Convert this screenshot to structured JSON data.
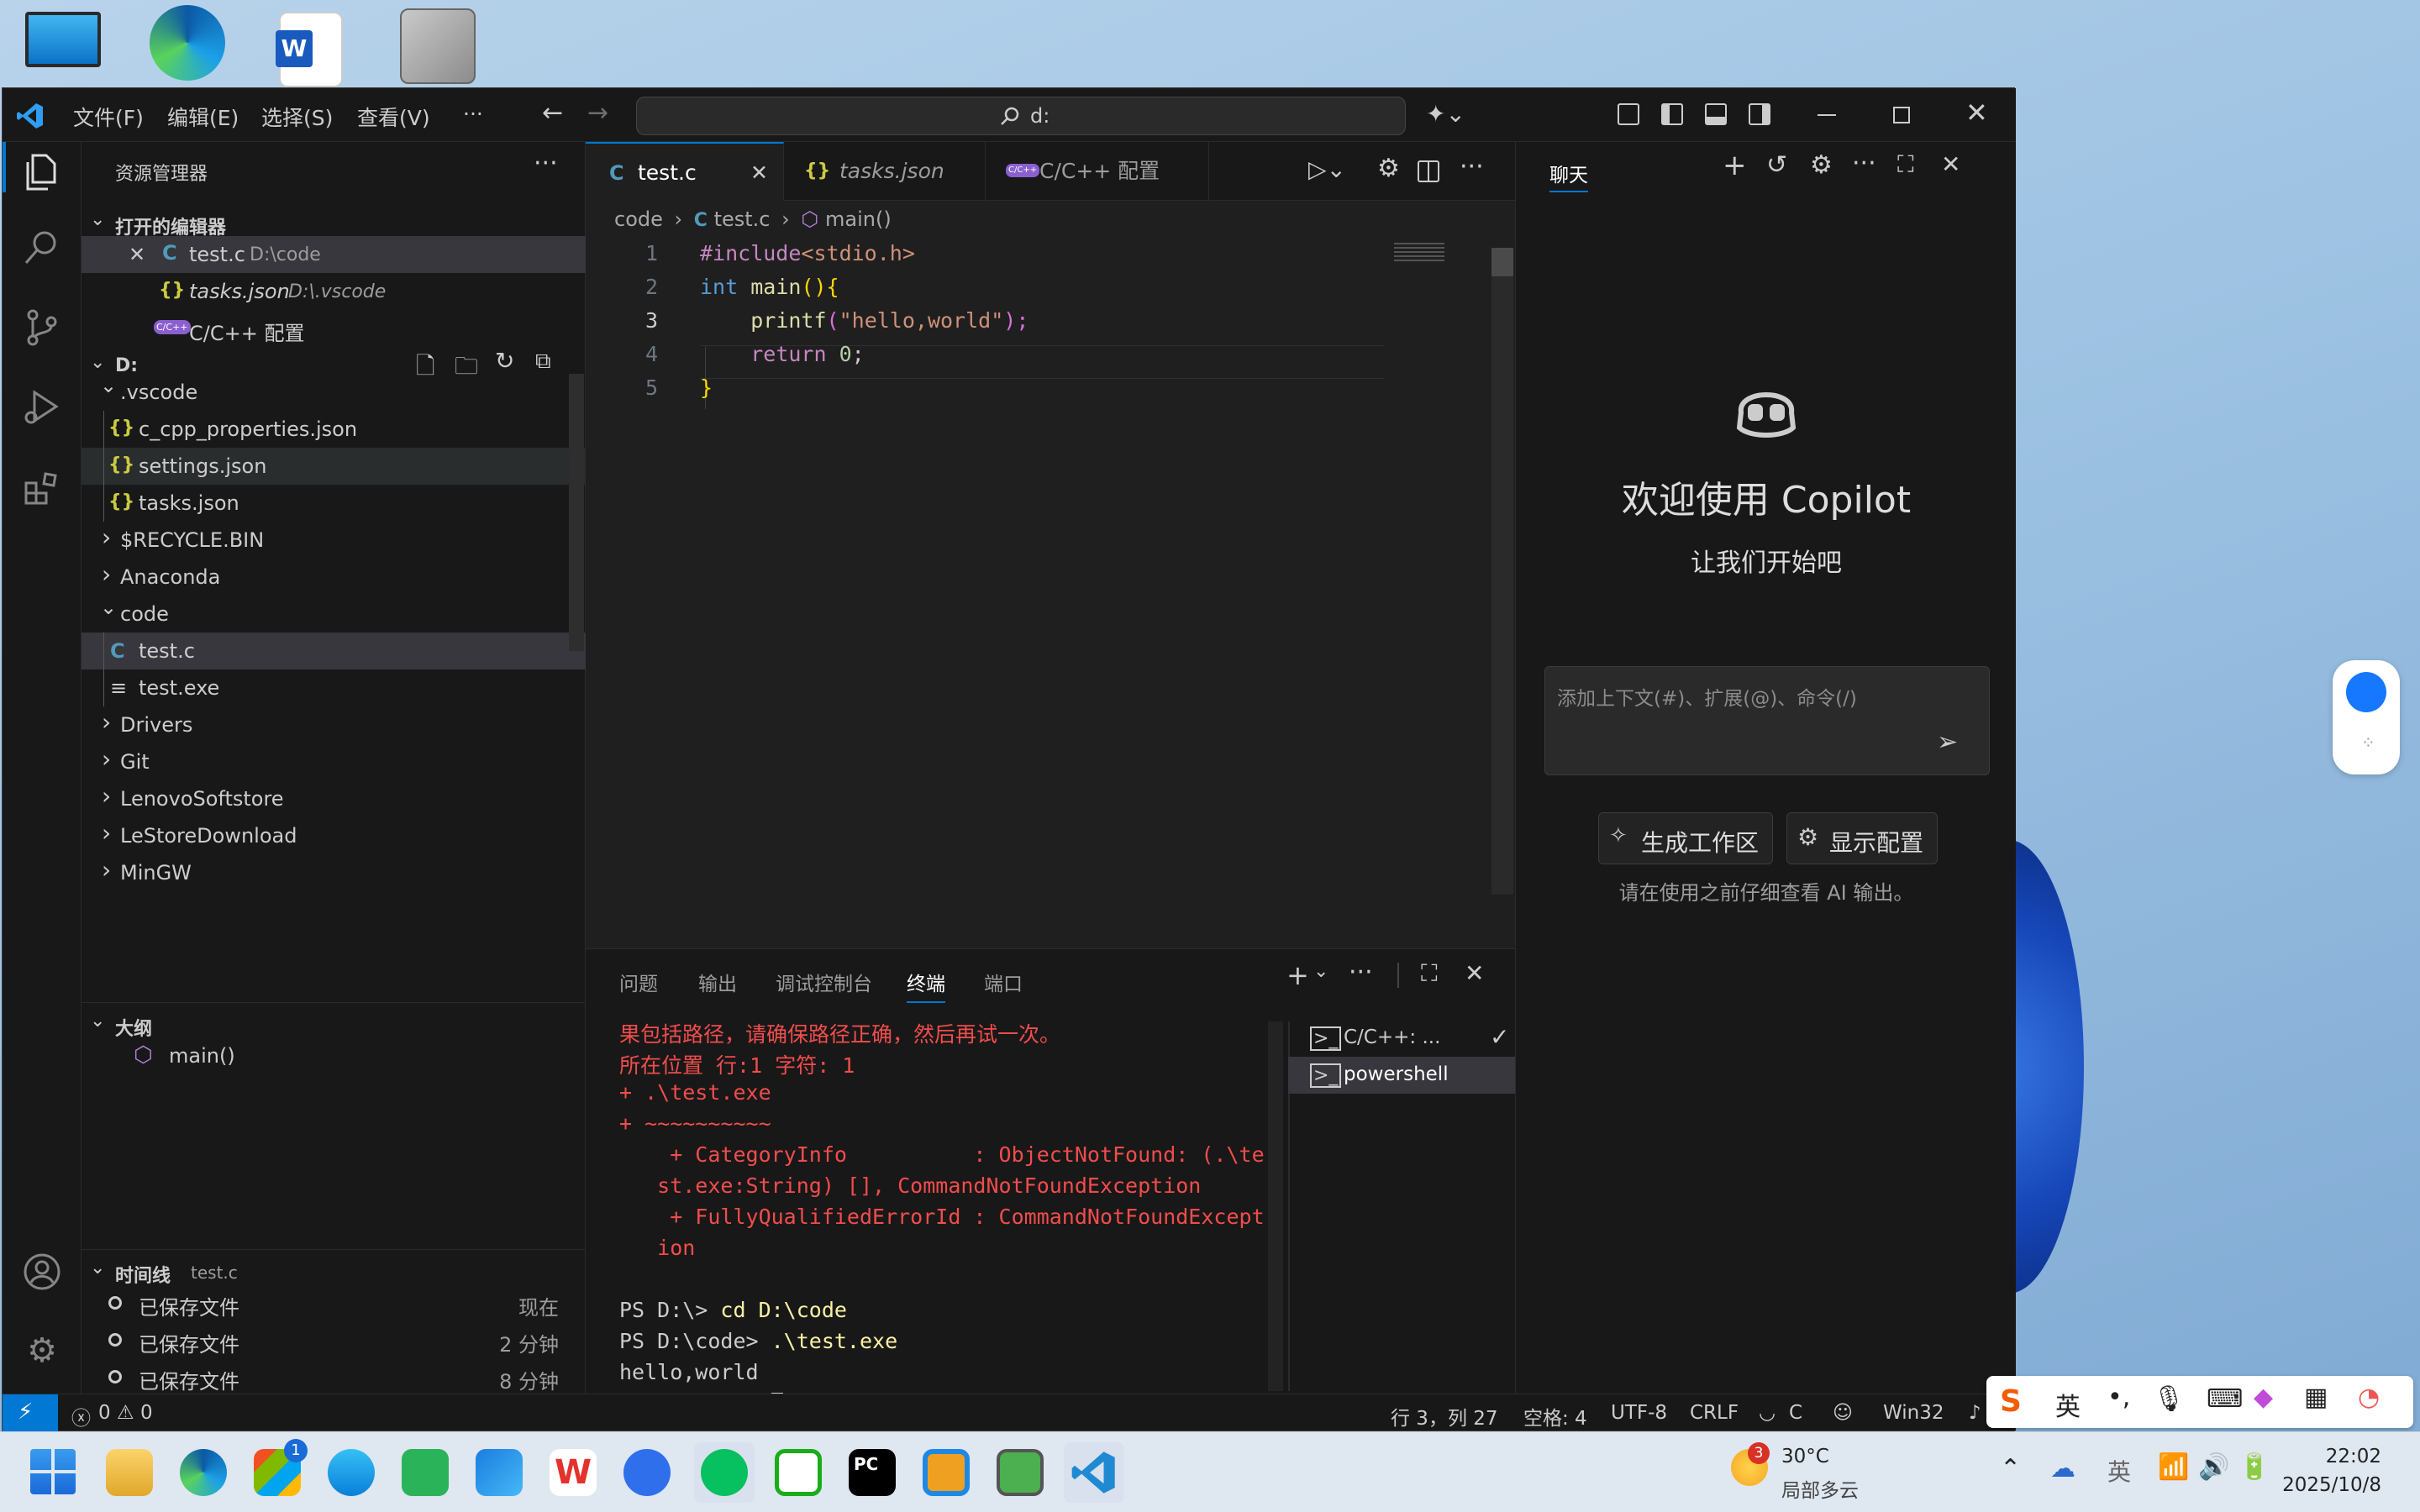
{
  "window": {
    "menu": [
      "文件(F)",
      "编辑(E)",
      "选择(S)",
      "查看(V)",
      "···"
    ],
    "command_center": "d:"
  },
  "sidebar": {
    "title": "资源管理器",
    "open_editors": {
      "header": "打开的编辑器",
      "items": [
        {
          "icon": "C",
          "name": "test.c",
          "path": "D:\\code"
        },
        {
          "icon": "{}",
          "name": "tasks.json",
          "path": "D:\\.vscode"
        },
        {
          "icon": "C/C++",
          "name": "C/C++ 配置",
          "path": ""
        }
      ]
    },
    "explorer": {
      "root": "D:",
      "items": [
        {
          "label": ".vscode",
          "kind": "folder-open"
        },
        {
          "label": "c_cpp_properties.json",
          "kind": "json"
        },
        {
          "label": "settings.json",
          "kind": "json"
        },
        {
          "label": "tasks.json",
          "kind": "json"
        },
        {
          "label": "$RECYCLE.BIN",
          "kind": "folder"
        },
        {
          "label": "Anaconda",
          "kind": "folder"
        },
        {
          "label": "code",
          "kind": "folder-open"
        },
        {
          "label": "test.c",
          "kind": "c"
        },
        {
          "label": "test.exe",
          "kind": "exe"
        },
        {
          "label": "Drivers",
          "kind": "folder"
        },
        {
          "label": "Git",
          "kind": "folder"
        },
        {
          "label": "LenovoSoftstore",
          "kind": "folder"
        },
        {
          "label": "LeStoreDownload",
          "kind": "folder"
        },
        {
          "label": "MinGW",
          "kind": "folder"
        }
      ]
    },
    "outline": {
      "header": "大纲",
      "items": [
        "main()"
      ]
    },
    "timeline": {
      "header": "时间线",
      "file": "test.c",
      "items": [
        {
          "label": "已保存文件",
          "time": "现在"
        },
        {
          "label": "已保存文件",
          "time": "2 分钟"
        },
        {
          "label": "已保存文件",
          "time": "8 分钟"
        }
      ]
    }
  },
  "editor": {
    "tabs": [
      {
        "icon": "C",
        "label": "test.c"
      },
      {
        "icon": "{}",
        "label": "tasks.json"
      },
      {
        "icon": "C/C++",
        "label": "C/C++ 配置"
      }
    ],
    "breadcrumb": [
      "code",
      "C",
      "test.c",
      "main()"
    ],
    "lines": [
      {
        "num": "1",
        "text": "#include<stdio.h>"
      },
      {
        "num": "2",
        "text": "int main(){"
      },
      {
        "num": "3",
        "text": "    printf(\"hello,world\");"
      },
      {
        "num": "4",
        "text": "    return 0;"
      },
      {
        "num": "5",
        "text": "}"
      }
    ],
    "tokens": {
      "include": "#include",
      "header": "<stdio.h>",
      "int_kw": "int",
      "main_fn": "main",
      "paren_brace": "(){",
      "printf": "printf",
      "lp": "(",
      "str": "\"hello,world\"",
      "rp": ");",
      "return_kw": "return",
      "zero": "0",
      "semi": ";",
      "close": "}"
    }
  },
  "panel": {
    "tabs": [
      "问题",
      "输出",
      "调试控制台",
      "终端",
      "端口"
    ],
    "terminal_lines": [
      "果包括路径，请确保路径正确，然后再试一次。",
      "所在位置 行:1 字符: 1",
      "+ .\\test.exe",
      "+ ~~~~~~~~~~",
      "    + CategoryInfo          : ObjectNotFound: (.\\te",
      "   st.exe:String) [], CommandNotFoundException",
      "    + FullyQualifiedErrorId : CommandNotFoundExcept",
      "   ion"
    ],
    "prompt_lines": [
      {
        "prompt": "PS D:\\> ",
        "cmd": "cd D:\\code"
      },
      {
        "prompt": "PS D:\\code> ",
        "cmd": ".\\test.exe"
      }
    ],
    "output": "hello,world",
    "last_prompt": "PS D:\\code> ",
    "terminals": [
      "C/C++: ...",
      "powershell"
    ]
  },
  "chat": {
    "tab": "聊天",
    "welcome_title": "欢迎使用 Copilot",
    "welcome_sub": "让我们开始吧",
    "input_placeholder": "添加上下文(#)、扩展(@)、命令(/)",
    "btn_generate": "生成工作区",
    "btn_config": "显示配置",
    "disclaimer": "请在使用之前仔细查看 AI 输出。"
  },
  "statusbar": {
    "errors": "0",
    "warnings": "0",
    "position": "行 3，列 27",
    "spaces": "空格: 4",
    "encoding": "UTF-8",
    "eol": "CRLF",
    "language": "C",
    "platform": "Win32"
  },
  "taskbar": {
    "weather_badge": "3",
    "weather_temp": "30°C",
    "weather_desc": "局部多云",
    "clock_time": "22:02",
    "clock_date": "2025/10/8",
    "store_badge": "1",
    "ime_lang": "英"
  },
  "colors": {
    "accent": "#0078d4",
    "error_text": "#f14c4c",
    "keyword": "#569cd6",
    "function": "#dcdcaa",
    "string": "#ce9178",
    "json_icon": "#cbcb41",
    "c_icon": "#519aba"
  }
}
